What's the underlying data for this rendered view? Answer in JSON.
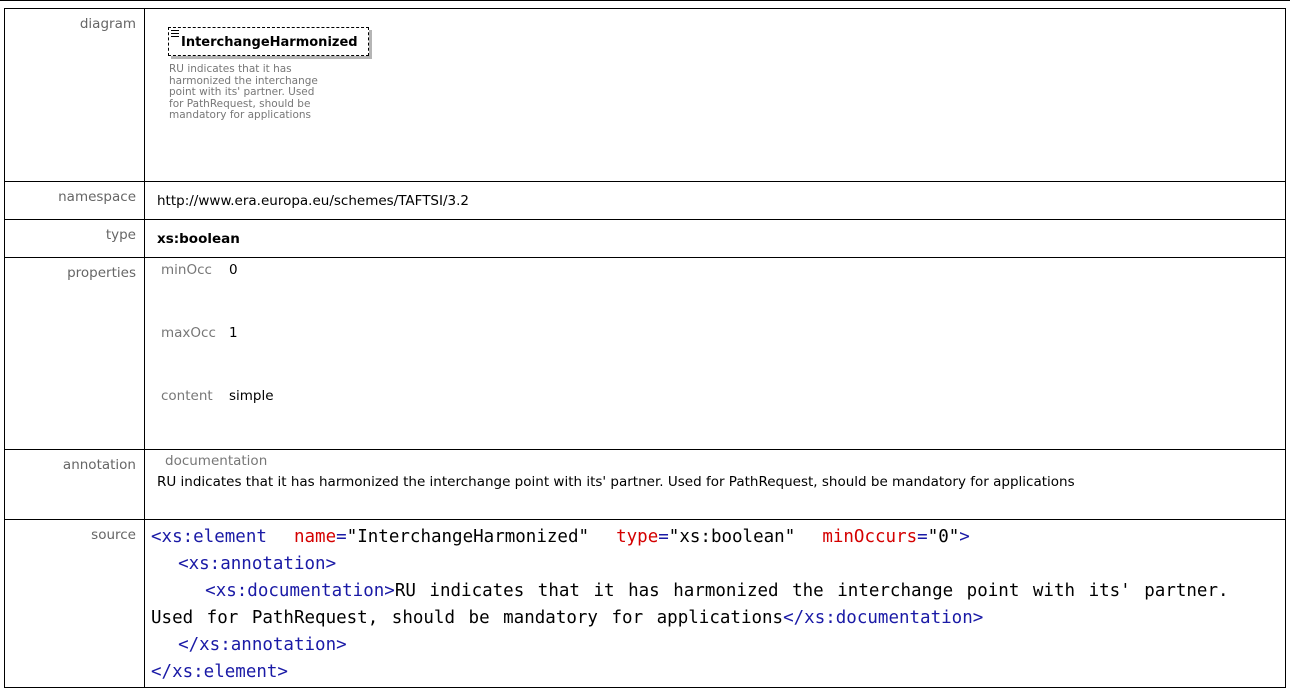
{
  "labels": {
    "diagram": "diagram",
    "namespace": "namespace",
    "type": "type",
    "properties": "properties",
    "annotation": "annotation",
    "source": "source"
  },
  "diagram": {
    "element_name": "InterchangeHarmonized",
    "documentation": "RU indicates that it has harmonized the interchange point with its' partner. Used for PathRequest, should be mandatory for applications"
  },
  "namespace": "http://www.era.europa.eu/schemes/TAFTSI/3.2",
  "type": "xs:boolean",
  "properties": [
    {
      "key": "minOcc",
      "value": "0"
    },
    {
      "key": "maxOcc",
      "value": "1"
    },
    {
      "key": "content",
      "value": "simple"
    }
  ],
  "annotation": {
    "key": "documentation",
    "text": "RU indicates that it has harmonized the interchange point with its' partner. Used for PathRequest, should be mandatory for applications"
  },
  "source": {
    "element_open": "<xs:element",
    "attr_name": "name",
    "val_name": "\"InterchangeHarmonized\"",
    "attr_type": "type",
    "val_type": "\"xs:boolean\"",
    "attr_minoccurs": "minOccurs",
    "val_minoccurs": "\"0\"",
    "tag_close_bracket": ">",
    "annotation_open": "<xs:annotation>",
    "documentation_open": "<xs:documentation>",
    "documentation_text": "RU indicates that it has harmonized the interchange point with its' partner. Used for PathRequest, should be mandatory for applications",
    "documentation_close": "</xs:documentation>",
    "annotation_close": "</xs:annotation>",
    "element_close": "</xs:element>",
    "equals": "="
  },
  "colors": {
    "tag": "#1a1aa6",
    "attribute": "#d40000",
    "label": "#666666"
  },
  "icons": {
    "ordering": "sequence-order-icon"
  }
}
